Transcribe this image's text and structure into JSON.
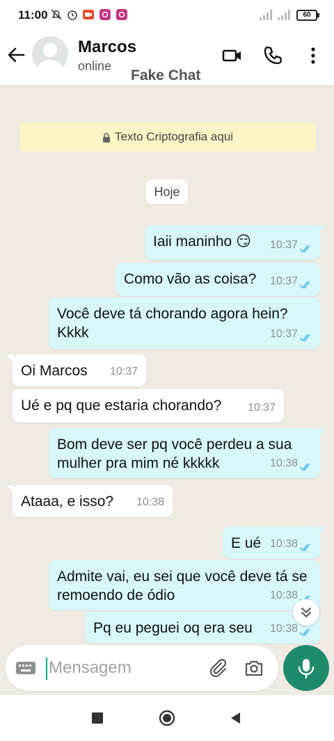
{
  "status_bar": {
    "time": "11:00",
    "battery": "60"
  },
  "header": {
    "contact_name": "Marcos",
    "contact_status": "online",
    "watermark": "Fake Chat"
  },
  "chat": {
    "encryption_notice": "Texto Criptografia aqui",
    "date_chip": "Hoje",
    "messages": [
      {
        "direction": "out",
        "text": "Iaii maninho 😏",
        "time": "10:37",
        "status": "read"
      },
      {
        "direction": "out",
        "text": "Como vão as coisa?",
        "time": "10:37",
        "status": "read"
      },
      {
        "direction": "out",
        "text": "Você deve tá chorando agora hein? Kkkk",
        "time": "10:37",
        "status": "read"
      },
      {
        "direction": "in",
        "text": "Oi Marcos",
        "time": "10:37"
      },
      {
        "direction": "in",
        "text": "Ué e pq que estaria chorando?",
        "time": "10:37"
      },
      {
        "direction": "out",
        "text": "Bom deve ser pq você perdeu a sua mulher pra mim né kkkkk",
        "time": "10:38",
        "status": "read"
      },
      {
        "direction": "in",
        "text": "Ataaa, e isso?",
        "time": "10:38"
      },
      {
        "direction": "out",
        "text": "E ué",
        "time": "10:38",
        "status": "read"
      },
      {
        "direction": "out",
        "text": "Admite vai, eu sei que você deve tá se remoendo de ódio",
        "time": "10:38",
        "status": "read"
      },
      {
        "direction": "out",
        "text": "Pq eu peguei oq era seu",
        "time": "10:38",
        "status": "read"
      }
    ]
  },
  "composer": {
    "placeholder": "Mensagem"
  },
  "colors": {
    "accent": "#1d8a6b",
    "outgoing_bubble": "#d7f7fb",
    "chat_bg": "#efeae2",
    "read_ticks": "#53bdeb"
  }
}
